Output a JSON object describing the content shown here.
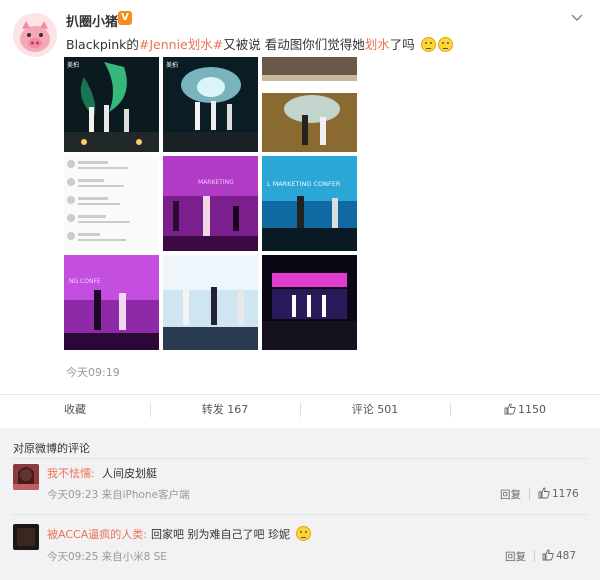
{
  "post": {
    "author": "扒圈小猪",
    "verified_badge": "V",
    "text_prefix": "Blackpink的",
    "hashtag": "#Jennie划水#",
    "text_middle": "又被说 看动图你们觉得她",
    "highlight": "划水",
    "text_suffix": "了吗",
    "emoji": "smile-emoji",
    "time": "今天09:19",
    "images": [
      {
        "name": "stage-image-1",
        "caption": "美拍"
      },
      {
        "name": "stage-image-2",
        "caption": "美拍"
      },
      {
        "name": "stage-image-3",
        "caption": ""
      },
      {
        "name": "comments-screenshot-image",
        "caption": ""
      },
      {
        "name": "stage-image-5",
        "caption": ""
      },
      {
        "name": "stage-image-6",
        "caption": ""
      },
      {
        "name": "stage-image-7",
        "caption": ""
      },
      {
        "name": "stage-image-8",
        "caption": ""
      },
      {
        "name": "stage-image-9",
        "caption": ""
      }
    ]
  },
  "actions": {
    "favorite": "收藏",
    "repost": "转发 167",
    "comment": "评论 501",
    "like_count": "1150"
  },
  "comments": {
    "title": "对原微博的评论",
    "items": [
      {
        "user": "我不怯懦:",
        "text": "人间皮划艇",
        "meta": "今天09:23 来自iPhone客户端",
        "reply": "回复",
        "likes": "1176"
      },
      {
        "user": "被ACCA逼疯的人类:",
        "text": "回家吧 别为难自己了吧 珍妮",
        "meta": "今天09:25 来自小米8 SE",
        "reply": "回复",
        "likes": "487"
      }
    ]
  },
  "colors": {
    "accent": "#eb7350",
    "badge": "#f78c1a",
    "comment_bg": "#f2f2f5"
  }
}
